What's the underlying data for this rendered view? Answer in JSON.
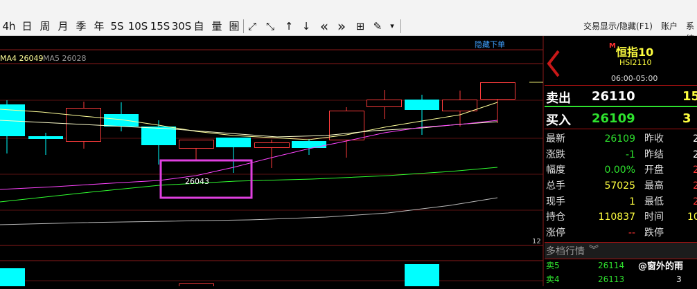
{
  "toolbar": {
    "items": [
      "4h",
      "日",
      "周",
      "月",
      "季",
      "年",
      "5S",
      "10S",
      "15S",
      "30S",
      "自",
      "量",
      "圏"
    ],
    "icons": [
      "expand-icon",
      "shrink-icon",
      "up-arrow-icon",
      "down-arrow-icon",
      "double-left-icon",
      "double-right-icon",
      "grid-icon",
      "draw-icon",
      "dropdown-icon"
    ],
    "icon_glyphs": [
      "⤢",
      "⤡",
      "↑",
      "↓",
      "«",
      "»",
      "⊞",
      "✎",
      "▾"
    ],
    "menu": [
      "交易显示/隐藏(F1)",
      "账户",
      "系统"
    ]
  },
  "chart": {
    "hide_orders": "隐藏下单",
    "ma_labels": [
      "MA4 26049",
      "MA5 26028"
    ],
    "annotation_value": "26043",
    "count_label": "12",
    "colors": {
      "up": "#ff3c3c",
      "down": "#00ffff",
      "ma4": "#ff44ff",
      "ma5": "#ffff99",
      "ma10": "#30ff30",
      "ma20": "#bbbbbb",
      "highlight": "#e040e0",
      "grid": "#8a1a1a"
    }
  },
  "right_panel": {
    "m_badge": "M",
    "instrument_name": "恒指10",
    "instrument_code": "HSI2110",
    "session": "06:00-05:00",
    "sell_label": "卖出",
    "sell_price": "26110",
    "sell_qty": "15",
    "buy_label": "买入",
    "buy_price": "26109",
    "buy_qty": "3",
    "quote_rows": [
      {
        "l1": "最新",
        "v1": "26109",
        "l2": "昨收",
        "v2": "2"
      },
      {
        "l1": "涨跌",
        "v1": "-1",
        "l2": "昨结",
        "v2": "2"
      },
      {
        "l1": "幅度",
        "v1": "0.00%",
        "l2": "开盘",
        "v2": "2"
      },
      {
        "l1": "总手",
        "v1": "57025",
        "l2": "最高",
        "v2": "2"
      },
      {
        "l1": "现手",
        "v1": "1",
        "l2": "最低",
        "v2": "2"
      },
      {
        "l1": "持仓",
        "v1": "110837",
        "l2": "时间",
        "v2": "10"
      },
      {
        "l1": "涨停",
        "v1": "--",
        "l2": "跌停",
        "v2": ""
      }
    ],
    "depth_title": "多档行情",
    "depth_rows": [
      {
        "label": "卖5",
        "price": "26114",
        "qty": ""
      },
      {
        "label": "卖4",
        "price": "26113",
        "qty": "3"
      }
    ],
    "watermark": "@窗外的雨"
  }
}
